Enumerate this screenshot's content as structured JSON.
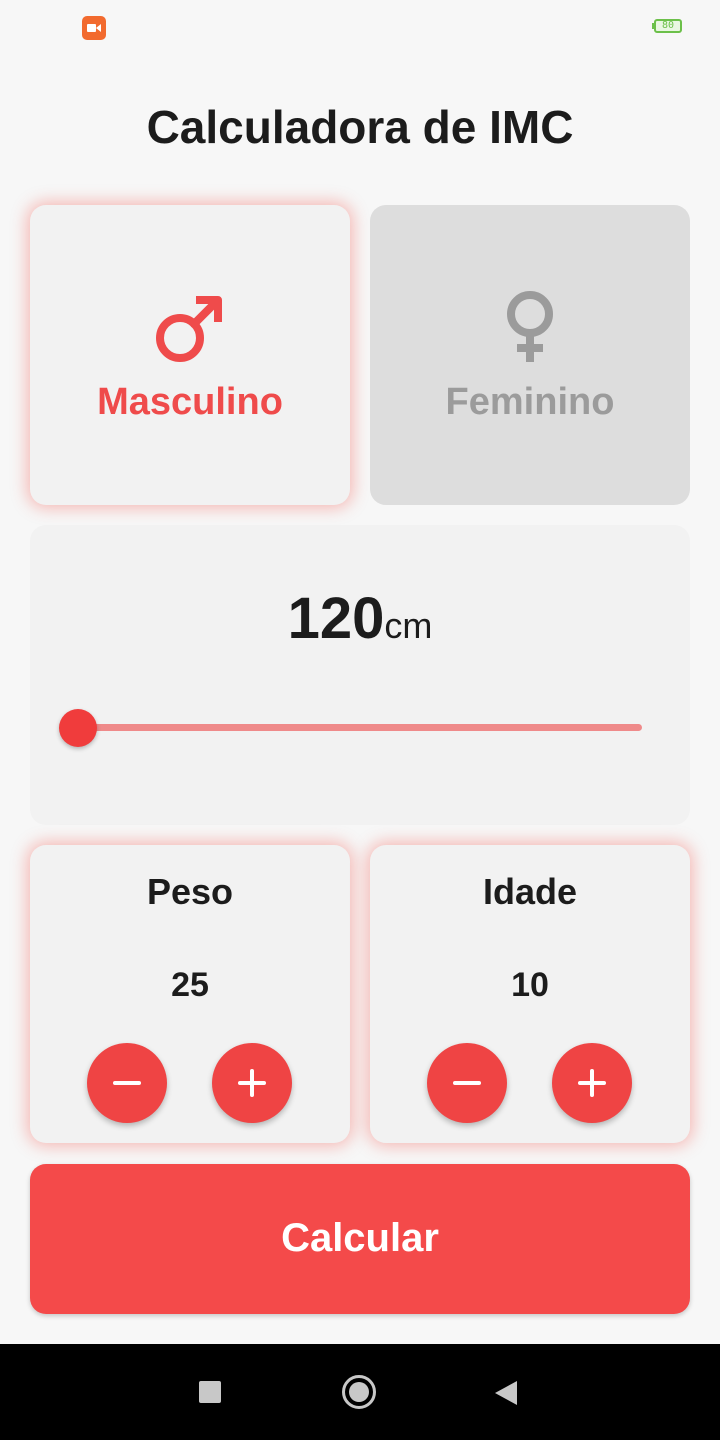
{
  "status_bar": {
    "left_icon": "screen-record-icon",
    "battery_level": "80"
  },
  "header": {
    "title": "Calculadora de IMC"
  },
  "gender": {
    "selected": "male",
    "male": {
      "label": "Masculino",
      "icon": "male-symbol-icon"
    },
    "female": {
      "label": "Feminino",
      "icon": "female-symbol-icon"
    }
  },
  "height": {
    "value": "120",
    "unit": "cm",
    "slider_fraction": 0.0
  },
  "weight": {
    "label": "Peso",
    "value": "25",
    "minus_icon": "minus-icon",
    "plus_icon": "plus-icon"
  },
  "age": {
    "label": "Idade",
    "value": "10",
    "minus_icon": "minus-icon",
    "plus_icon": "plus-icon"
  },
  "calculate": {
    "label": "Calcular"
  },
  "colors": {
    "accent": "#ef4b4b",
    "inactive_text": "#9b9b9b",
    "card_bg": "#f2f2f2",
    "inactive_card_bg": "#dddddd"
  },
  "nav_bar": {
    "icons": [
      "recents-square-icon",
      "home-circle-icon",
      "back-triangle-icon"
    ]
  }
}
